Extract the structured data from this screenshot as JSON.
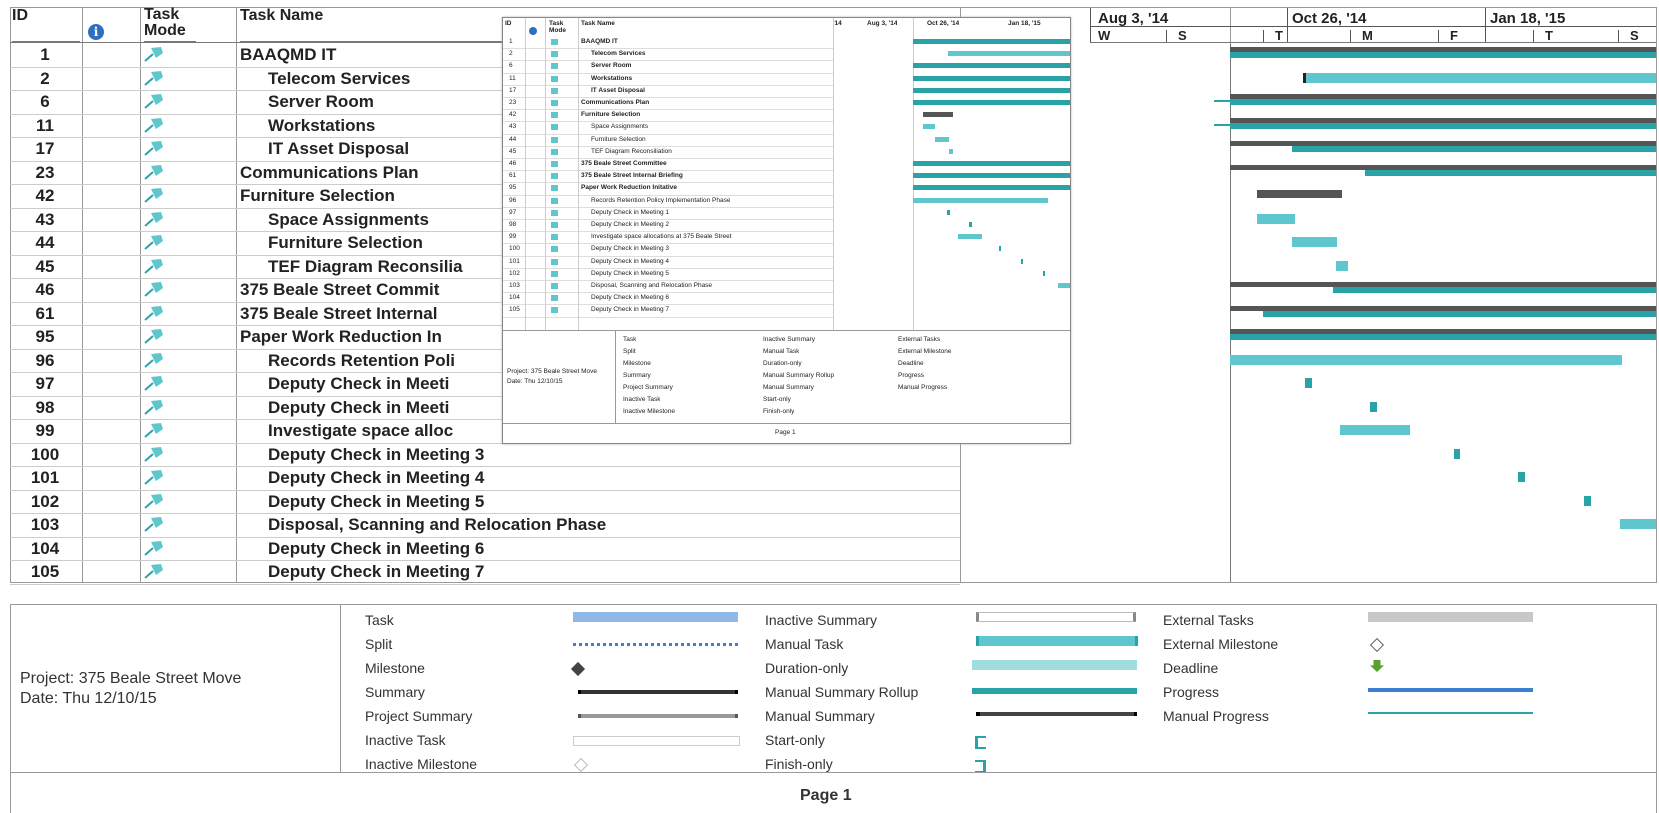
{
  "columns": {
    "id": "ID",
    "task_mode": "Task Mode",
    "task_name": "Task Name"
  },
  "tasks": [
    {
      "id": "1",
      "name": "BAAQMD IT",
      "level": 0
    },
    {
      "id": "2",
      "name": "Telecom Services",
      "level": 1
    },
    {
      "id": "6",
      "name": "Server Room",
      "level": 1
    },
    {
      "id": "11",
      "name": "Workstations",
      "level": 1
    },
    {
      "id": "17",
      "name": "IT Asset Disposal",
      "level": 1
    },
    {
      "id": "23",
      "name": "Communications Plan",
      "level": 0
    },
    {
      "id": "42",
      "name": "Furniture Selection",
      "level": 0
    },
    {
      "id": "43",
      "name": "Space Assignments",
      "level": 1
    },
    {
      "id": "44",
      "name": "Furniture Selection",
      "level": 1
    },
    {
      "id": "45",
      "name": "TEF Diagram Reconsilia",
      "level": 1
    },
    {
      "id": "46",
      "name": "375 Beale Street Commit",
      "level": 0
    },
    {
      "id": "61",
      "name": "375 Beale Street Internal",
      "level": 0
    },
    {
      "id": "95",
      "name": "Paper Work Reduction In",
      "level": 0
    },
    {
      "id": "96",
      "name": "Records Retention Poli",
      "level": 1
    },
    {
      "id": "97",
      "name": "Deputy Check in Meeti",
      "level": 1
    },
    {
      "id": "98",
      "name": "Deputy Check in Meeti",
      "level": 1
    },
    {
      "id": "99",
      "name": "Investigate space alloc",
      "level": 1
    },
    {
      "id": "100",
      "name": "Deputy Check in Meeting 3",
      "level": 1
    },
    {
      "id": "101",
      "name": "Deputy Check in Meeting 4",
      "level": 1
    },
    {
      "id": "102",
      "name": "Deputy Check in Meeting 5",
      "level": 1
    },
    {
      "id": "103",
      "name": "Disposal, Scanning and Relocation Phase",
      "level": 1
    },
    {
      "id": "104",
      "name": "Deputy Check in Meeting 6",
      "level": 1
    },
    {
      "id": "105",
      "name": "Deputy Check in Meeting 7",
      "level": 1
    }
  ],
  "timeline": {
    "top": [
      "Aug 3, '14",
      "Oct 26, '14",
      "Jan 18, '15"
    ],
    "bottom": [
      "W",
      "S",
      "T",
      "M",
      "F",
      "T",
      "S"
    ]
  },
  "legend": {
    "project": "Project: 375 Beale Street Move",
    "date": "Date: Thu 12/10/15",
    "col1": [
      "Task",
      "Split",
      "Milestone",
      "Summary",
      "Project Summary",
      "Inactive Task",
      "Inactive Milestone"
    ],
    "col2": [
      "Inactive Summary",
      "Manual Task",
      "Duration-only",
      "Manual Summary Rollup",
      "Manual Summary",
      "Start-only",
      "Finish-only"
    ],
    "col3": [
      "External Tasks",
      "External Milestone",
      "Deadline",
      "Progress",
      "Manual Progress"
    ]
  },
  "footer": {
    "page": "Page 1"
  },
  "inset": {
    "headers": {
      "id": "ID",
      "mode": "Task Mode",
      "name": "Task Name",
      "t1": "'14",
      "t2": "Aug 3, '14",
      "t3": "Oct 26, '14",
      "t4": "Jan 18, '15"
    },
    "rows": [
      {
        "id": "1",
        "name": "BAAQMD IT"
      },
      {
        "id": "2",
        "name": "Telecom Services"
      },
      {
        "id": "6",
        "name": "Server Room"
      },
      {
        "id": "11",
        "name": "Workstations"
      },
      {
        "id": "17",
        "name": "IT Asset Disposal"
      },
      {
        "id": "23",
        "name": "Communications Plan"
      },
      {
        "id": "42",
        "name": "Furniture Selection"
      },
      {
        "id": "43",
        "name": "Space Assignments"
      },
      {
        "id": "44",
        "name": "Furniture Selection"
      },
      {
        "id": "45",
        "name": "TEF Diagram Reconsiliation"
      },
      {
        "id": "46",
        "name": "375 Beale Street Committee"
      },
      {
        "id": "61",
        "name": "375 Beale Street Internal Briefing"
      },
      {
        "id": "95",
        "name": "Paper Work Reduction Initative"
      },
      {
        "id": "96",
        "name": "Records Retention Policy Implementation Phase"
      },
      {
        "id": "97",
        "name": "Deputy Check in Meeting 1"
      },
      {
        "id": "98",
        "name": "Deputy Check in Meeting 2"
      },
      {
        "id": "99",
        "name": "Investigate space allocations at 375 Beale Street"
      },
      {
        "id": "100",
        "name": "Deputy Check in Meeting 3"
      },
      {
        "id": "101",
        "name": "Deputy Check in Meeting 4"
      },
      {
        "id": "102",
        "name": "Deputy Check in Meeting 5"
      },
      {
        "id": "103",
        "name": "Disposal, Scanning and Relocation Phase"
      },
      {
        "id": "104",
        "name": "Deputy Check in Meeting 6"
      },
      {
        "id": "105",
        "name": "Deputy Check in Meeting 7"
      }
    ],
    "project": "Project: 375 Beale Street Move",
    "date": "Date: Thu 12/10/15",
    "page": "Page 1"
  },
  "colors": {
    "teal": "#5ec6cc",
    "teal_dark": "#2aa3a8",
    "summary": "#555555",
    "task_blue": "#8db8e8",
    "progress": "#3a7fd0",
    "deadline": "#5aa02c"
  }
}
